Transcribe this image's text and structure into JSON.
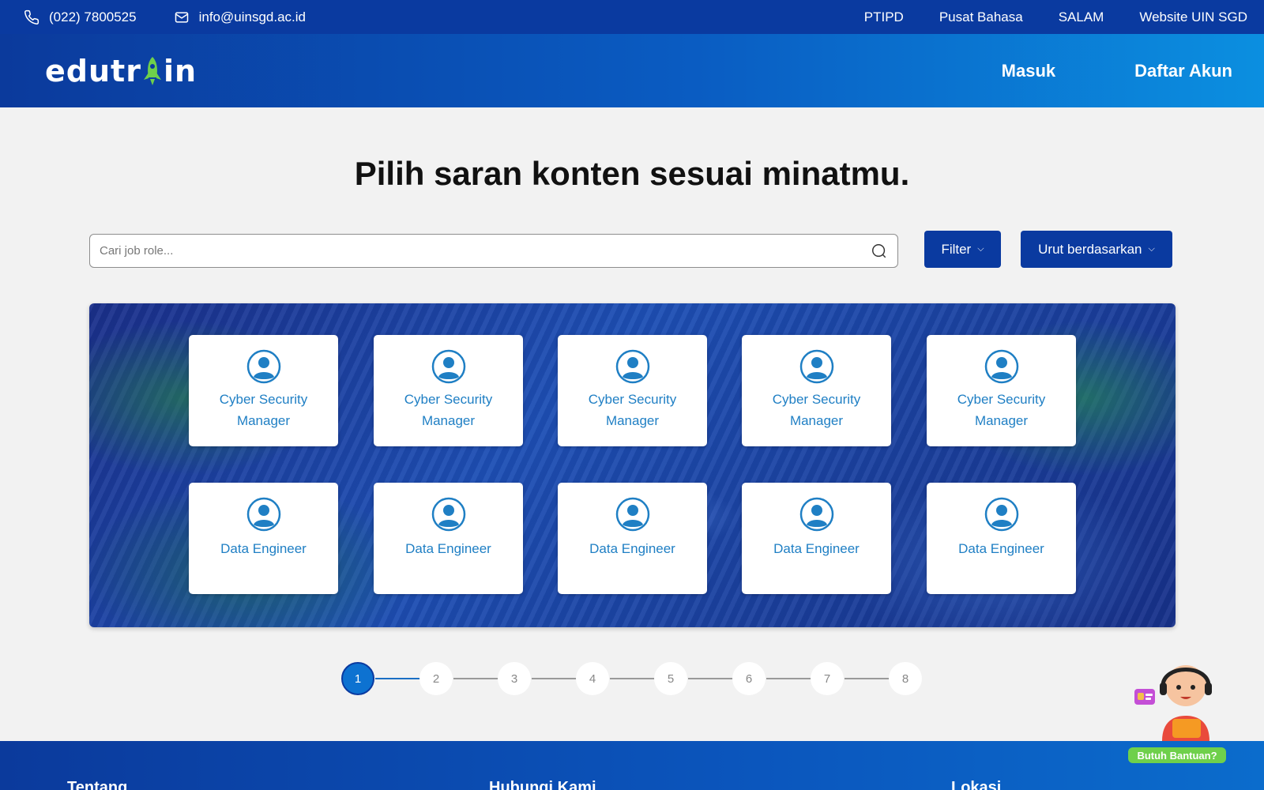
{
  "topbar": {
    "phone": "(022) 7800525",
    "email": "info@uinsgd.ac.id",
    "links": [
      "PTIPD",
      "Pusat Bahasa",
      "SALAM",
      "Website UIN SGD"
    ]
  },
  "header": {
    "logo_left": "edutr",
    "logo_right": "in",
    "nav": {
      "login": "Masuk",
      "register": "Daftar Akun"
    }
  },
  "main": {
    "title": "Pilih saran konten sesuai minatmu.",
    "search": {
      "placeholder": "Cari job role...",
      "value": ""
    },
    "filter_label": "Filter",
    "sort_label": "Urut berdasarkan"
  },
  "cards": [
    {
      "label": "Cyber Security Manager"
    },
    {
      "label": "Cyber Security Manager"
    },
    {
      "label": "Cyber Security Manager"
    },
    {
      "label": "Cyber Security Manager"
    },
    {
      "label": "Cyber Security Manager"
    },
    {
      "label": "Data Engineer"
    },
    {
      "label": "Data Engineer"
    },
    {
      "label": "Data Engineer"
    },
    {
      "label": "Data Engineer"
    },
    {
      "label": "Data Engineer"
    }
  ],
  "pagination": {
    "pages": [
      "1",
      "2",
      "3",
      "4",
      "5",
      "6",
      "7",
      "8"
    ],
    "current": "1"
  },
  "footer": {
    "about": "Tentang",
    "contact": "Hubungi Kami",
    "location": "Lokasi"
  },
  "help": {
    "label": "Butuh Bantuan?"
  },
  "colors": {
    "primary": "#0a3aa0",
    "accent": "#1f7fc4",
    "logo_accent": "#6fd04b"
  },
  "icons": [
    "phone-icon",
    "mail-icon",
    "search-icon",
    "chevron-down-icon",
    "user-circle-icon",
    "rocket-icon"
  ]
}
